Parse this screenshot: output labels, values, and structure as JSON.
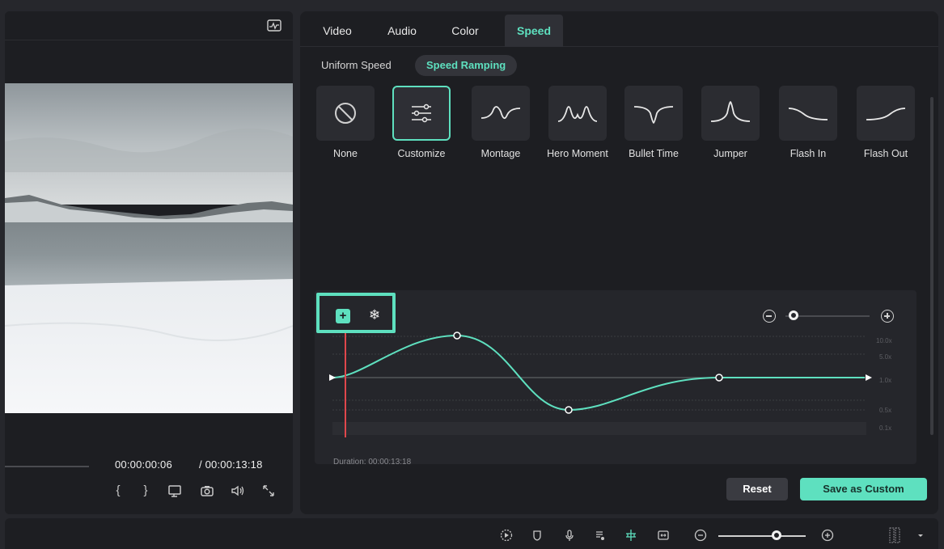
{
  "tabs": [
    {
      "label": "Video"
    },
    {
      "label": "Audio"
    },
    {
      "label": "Color"
    },
    {
      "label": "Speed",
      "active": true
    }
  ],
  "subtabs": [
    {
      "label": "Uniform Speed"
    },
    {
      "label": "Speed Ramping",
      "active": true
    }
  ],
  "presets": [
    {
      "label": "None",
      "icon": "none-icon"
    },
    {
      "label": "Customize",
      "icon": "sliders-icon",
      "selected": true
    },
    {
      "label": "Montage",
      "icon": "montage-curve-icon"
    },
    {
      "label": "Hero Moment",
      "icon": "hero-moment-curve-icon"
    },
    {
      "label": "Bullet Time",
      "icon": "bullet-time-curve-icon"
    },
    {
      "label": "Jumper",
      "icon": "jumper-curve-icon"
    },
    {
      "label": "Flash In",
      "icon": "flash-in-curve-icon"
    },
    {
      "label": "Flash Out",
      "icon": "flash-out-curve-icon"
    }
  ],
  "curve": {
    "speed_labels": [
      "10.0x",
      "5.0x",
      "1.0x",
      "0.5x",
      "0.1x"
    ],
    "duration_text": "Duration: 00:00:13:18"
  },
  "preview": {
    "current_time": "00:00:00:06",
    "total_time": "/ 00:00:13:18"
  },
  "buttons": {
    "reset": "Reset",
    "save_custom": "Save as Custom"
  },
  "colors": {
    "accent": "#5ee0bf",
    "panel": "#1d1e22",
    "playhead": "#e0474c"
  }
}
